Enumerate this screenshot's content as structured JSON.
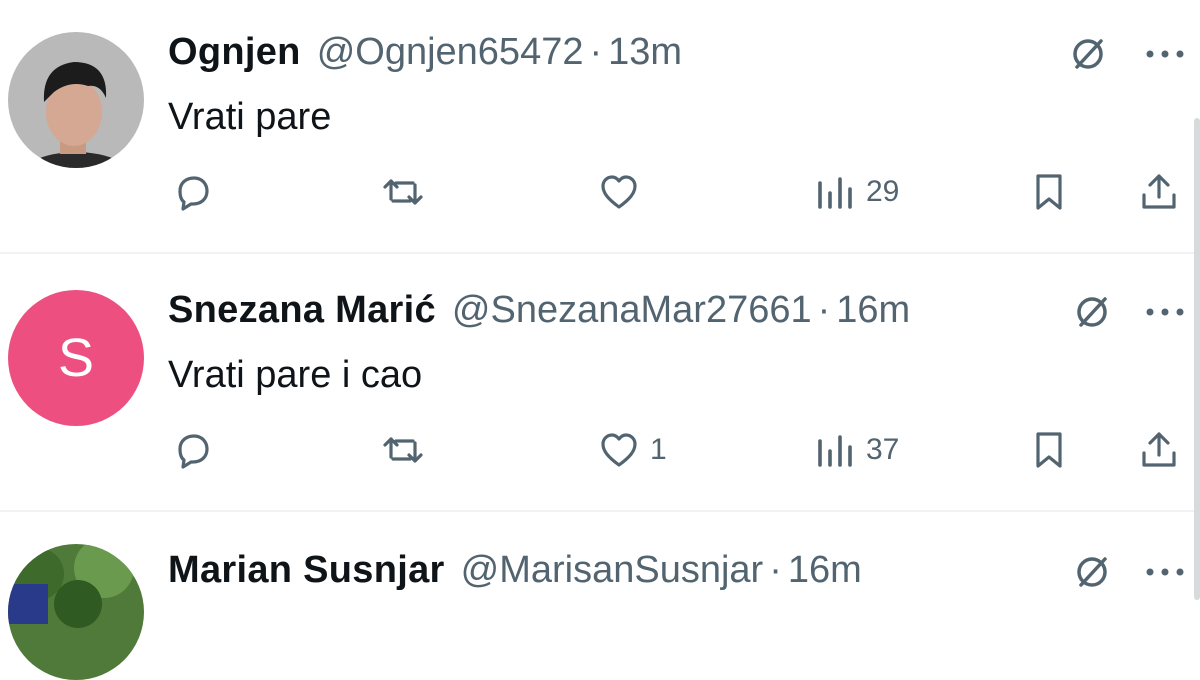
{
  "tweets": [
    {
      "name": "Ognjen",
      "handle": "@Ognjen65472",
      "separator": "·",
      "time": "13m",
      "text": "Vrati pare",
      "avatar_type": "photo",
      "reply_count": "",
      "retweet_count": "",
      "like_count": "",
      "views_count": "29"
    },
    {
      "name": "Snezana Marić",
      "handle": "@SnezanaMar27661",
      "separator": "·",
      "time": "16m",
      "text": "Vrati pare i cao",
      "avatar_letter": "S",
      "avatar_color": "#ec4f80",
      "reply_count": "",
      "retweet_count": "",
      "like_count": "1",
      "views_count": "37"
    },
    {
      "name": "Marian Susnjar",
      "handle": "@MarisanSusnjar",
      "separator": "·",
      "time": "16m",
      "avatar_type": "photo"
    }
  ],
  "icons": {
    "reply": "reply-icon",
    "retweet": "retweet-icon",
    "like": "heart-icon",
    "views": "views-icon",
    "bookmark": "bookmark-icon",
    "share": "share-icon",
    "grok": "grok-icon",
    "more": "more-icon"
  },
  "colors": {
    "text": "#0f1419",
    "secondary": "#536471",
    "divider": "#eff3f4",
    "avatar_s": "#ec4f80"
  }
}
